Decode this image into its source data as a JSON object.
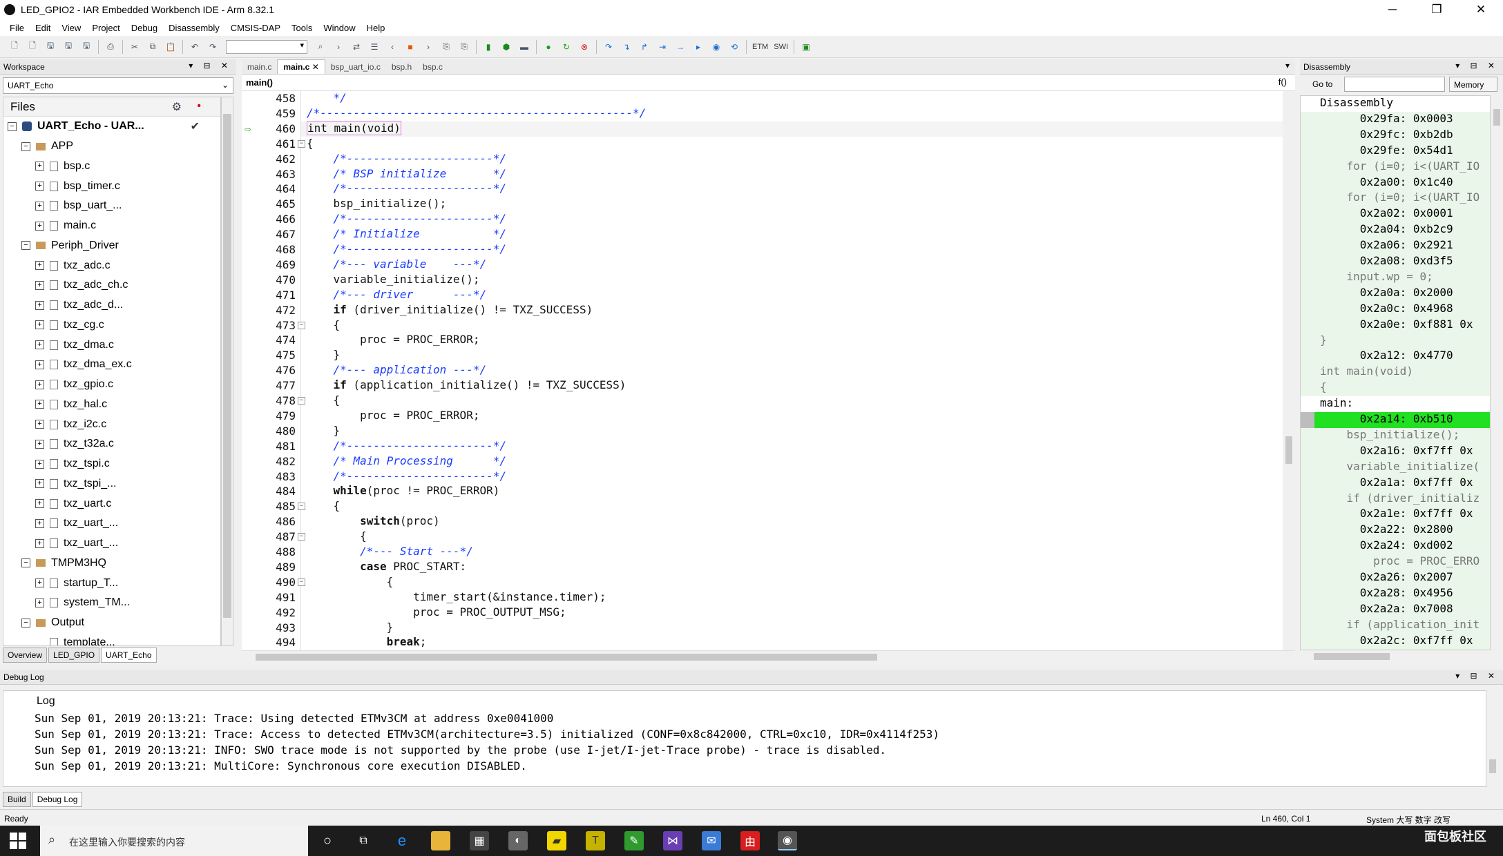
{
  "window": {
    "title": "LED_GPIO2 - IAR Embedded Workbench IDE - Arm 8.32.1",
    "minimize": "─",
    "maximize": "❐",
    "close": "✕"
  },
  "menu": [
    "File",
    "Edit",
    "View",
    "Project",
    "Debug",
    "Disassembly",
    "CMSIS-DAP",
    "Tools",
    "Window",
    "Help"
  ],
  "toolbar": {
    "etm_label": "ETM",
    "swi_label": "SWI"
  },
  "workspace": {
    "header": "Workspace",
    "combo": "UART_Echo",
    "files_header": "Files",
    "tree": [
      {
        "label": "UART_Echo - UAR...",
        "level": 0,
        "kind": "project",
        "exp": "−",
        "bold": true,
        "check": "✔"
      },
      {
        "label": "APP",
        "level": 1,
        "kind": "folder",
        "exp": "−"
      },
      {
        "label": "bsp.c",
        "level": 2,
        "kind": "file",
        "exp": "+"
      },
      {
        "label": "bsp_timer.c",
        "level": 2,
        "kind": "file",
        "exp": "+"
      },
      {
        "label": "bsp_uart_...",
        "level": 2,
        "kind": "file",
        "exp": "+"
      },
      {
        "label": "main.c",
        "level": 2,
        "kind": "file",
        "exp": "+"
      },
      {
        "label": "Periph_Driver",
        "level": 1,
        "kind": "folder",
        "exp": "−"
      },
      {
        "label": "txz_adc.c",
        "level": 2,
        "kind": "file",
        "exp": "+"
      },
      {
        "label": "txz_adc_ch.c",
        "level": 2,
        "kind": "file",
        "exp": "+"
      },
      {
        "label": "txz_adc_d...",
        "level": 2,
        "kind": "file",
        "exp": "+"
      },
      {
        "label": "txz_cg.c",
        "level": 2,
        "kind": "file",
        "exp": "+"
      },
      {
        "label": "txz_dma.c",
        "level": 2,
        "kind": "file",
        "exp": "+"
      },
      {
        "label": "txz_dma_ex.c",
        "level": 2,
        "kind": "file",
        "exp": "+"
      },
      {
        "label": "txz_gpio.c",
        "level": 2,
        "kind": "file",
        "exp": "+"
      },
      {
        "label": "txz_hal.c",
        "level": 2,
        "kind": "file",
        "exp": "+"
      },
      {
        "label": "txz_i2c.c",
        "level": 2,
        "kind": "file",
        "exp": "+"
      },
      {
        "label": "txz_t32a.c",
        "level": 2,
        "kind": "file",
        "exp": "+"
      },
      {
        "label": "txz_tspi.c",
        "level": 2,
        "kind": "file",
        "exp": "+"
      },
      {
        "label": "txz_tspi_...",
        "level": 2,
        "kind": "file",
        "exp": "+"
      },
      {
        "label": "txz_uart.c",
        "level": 2,
        "kind": "file",
        "exp": "+"
      },
      {
        "label": "txz_uart_...",
        "level": 2,
        "kind": "file",
        "exp": "+"
      },
      {
        "label": "txz_uart_...",
        "level": 2,
        "kind": "file",
        "exp": "+"
      },
      {
        "label": "TMPM3HQ",
        "level": 1,
        "kind": "folder",
        "exp": "−"
      },
      {
        "label": "startup_T...",
        "level": 2,
        "kind": "file",
        "exp": "+"
      },
      {
        "label": "system_TM...",
        "level": 2,
        "kind": "file",
        "exp": "+"
      },
      {
        "label": "Output",
        "level": 1,
        "kind": "folder",
        "exp": "−"
      },
      {
        "label": "template...",
        "level": 2,
        "kind": "file",
        "exp": ""
      }
    ],
    "tabs": [
      "Overview",
      "LED_GPIO",
      "UART_Echo"
    ]
  },
  "editor": {
    "tabs": [
      "main.c",
      "main.c",
      "bsp_uart_io.c",
      "bsp.h",
      "bsp.c"
    ],
    "function_combo": "main()",
    "fx_label": "f()",
    "lines": [
      {
        "n": "458",
        "segs": [
          {
            "t": "    */",
            "c": "cm"
          }
        ]
      },
      {
        "n": "459",
        "segs": [
          {
            "t": "/*-----------------------------------------------*/",
            "c": "cm"
          }
        ]
      },
      {
        "n": "460",
        "cur": true,
        "segs": [
          {
            "t": "int main(void)",
            "c": "hl"
          }
        ]
      },
      {
        "n": "461",
        "fold": "−",
        "segs": [
          {
            "t": "{",
            "c": ""
          }
        ]
      },
      {
        "n": "462",
        "segs": [
          {
            "t": "    ",
            "c": ""
          },
          {
            "t": "/*----------------------*/",
            "c": "cm"
          }
        ]
      },
      {
        "n": "463",
        "segs": [
          {
            "t": "    ",
            "c": ""
          },
          {
            "t": "/* BSP initialize       */",
            "c": "cm"
          }
        ]
      },
      {
        "n": "464",
        "segs": [
          {
            "t": "    ",
            "c": ""
          },
          {
            "t": "/*----------------------*/",
            "c": "cm"
          }
        ]
      },
      {
        "n": "465",
        "segs": [
          {
            "t": "    bsp_initialize();",
            "c": ""
          }
        ]
      },
      {
        "n": "466",
        "segs": [
          {
            "t": "    ",
            "c": ""
          },
          {
            "t": "/*----------------------*/",
            "c": "cm"
          }
        ]
      },
      {
        "n": "467",
        "segs": [
          {
            "t": "    ",
            "c": ""
          },
          {
            "t": "/* Initialize           */",
            "c": "cm"
          }
        ]
      },
      {
        "n": "468",
        "segs": [
          {
            "t": "    ",
            "c": ""
          },
          {
            "t": "/*----------------------*/",
            "c": "cm"
          }
        ]
      },
      {
        "n": "469",
        "segs": [
          {
            "t": "    ",
            "c": ""
          },
          {
            "t": "/*--- variable    ---*/",
            "c": "cm"
          }
        ]
      },
      {
        "n": "470",
        "segs": [
          {
            "t": "    variable_initialize();",
            "c": ""
          }
        ]
      },
      {
        "n": "471",
        "segs": [
          {
            "t": "    ",
            "c": ""
          },
          {
            "t": "/*--- driver      ---*/",
            "c": "cm"
          }
        ]
      },
      {
        "n": "472",
        "segs": [
          {
            "t": "    ",
            "c": ""
          },
          {
            "t": "if",
            "c": "kw"
          },
          {
            "t": " (driver_initialize() != TXZ_SUCCESS)",
            "c": ""
          }
        ]
      },
      {
        "n": "473",
        "fold": "−",
        "segs": [
          {
            "t": "    {",
            "c": ""
          }
        ]
      },
      {
        "n": "474",
        "segs": [
          {
            "t": "        proc = PROC_ERROR;",
            "c": ""
          }
        ]
      },
      {
        "n": "475",
        "segs": [
          {
            "t": "    }",
            "c": ""
          }
        ]
      },
      {
        "n": "476",
        "segs": [
          {
            "t": "    ",
            "c": ""
          },
          {
            "t": "/*--- application ---*/",
            "c": "cm"
          }
        ]
      },
      {
        "n": "477",
        "segs": [
          {
            "t": "    ",
            "c": ""
          },
          {
            "t": "if",
            "c": "kw"
          },
          {
            "t": " (application_initialize() != TXZ_SUCCESS)",
            "c": ""
          }
        ]
      },
      {
        "n": "478",
        "fold": "−",
        "segs": [
          {
            "t": "    {",
            "c": ""
          }
        ]
      },
      {
        "n": "479",
        "segs": [
          {
            "t": "        proc = PROC_ERROR;",
            "c": ""
          }
        ]
      },
      {
        "n": "480",
        "segs": [
          {
            "t": "    }",
            "c": ""
          }
        ]
      },
      {
        "n": "481",
        "segs": [
          {
            "t": "    ",
            "c": ""
          },
          {
            "t": "/*----------------------*/",
            "c": "cm"
          }
        ]
      },
      {
        "n": "482",
        "segs": [
          {
            "t": "    ",
            "c": ""
          },
          {
            "t": "/* Main Processing      */",
            "c": "cm"
          }
        ]
      },
      {
        "n": "483",
        "segs": [
          {
            "t": "    ",
            "c": ""
          },
          {
            "t": "/*----------------------*/",
            "c": "cm"
          }
        ]
      },
      {
        "n": "484",
        "segs": [
          {
            "t": "    ",
            "c": ""
          },
          {
            "t": "while",
            "c": "kw"
          },
          {
            "t": "(proc != PROC_ERROR)",
            "c": ""
          }
        ]
      },
      {
        "n": "485",
        "fold": "−",
        "segs": [
          {
            "t": "    {",
            "c": ""
          }
        ]
      },
      {
        "n": "486",
        "segs": [
          {
            "t": "        ",
            "c": ""
          },
          {
            "t": "switch",
            "c": "kw"
          },
          {
            "t": "(proc)",
            "c": ""
          }
        ]
      },
      {
        "n": "487",
        "fold": "−",
        "segs": [
          {
            "t": "        {",
            "c": ""
          }
        ]
      },
      {
        "n": "488",
        "segs": [
          {
            "t": "        ",
            "c": ""
          },
          {
            "t": "/*--- Start ---*/",
            "c": "cm"
          }
        ]
      },
      {
        "n": "489",
        "segs": [
          {
            "t": "        ",
            "c": ""
          },
          {
            "t": "case",
            "c": "kw"
          },
          {
            "t": " PROC_START:",
            "c": ""
          }
        ]
      },
      {
        "n": "490",
        "fold": "−",
        "segs": [
          {
            "t": "            {",
            "c": ""
          }
        ]
      },
      {
        "n": "491",
        "segs": [
          {
            "t": "                timer_start(&instance.timer);",
            "c": ""
          }
        ]
      },
      {
        "n": "492",
        "segs": [
          {
            "t": "                proc = PROC_OUTPUT_MSG;",
            "c": ""
          }
        ]
      },
      {
        "n": "493",
        "segs": [
          {
            "t": "            }",
            "c": ""
          }
        ]
      },
      {
        "n": "494",
        "segs": [
          {
            "t": "            ",
            "c": ""
          },
          {
            "t": "break",
            "c": "kw"
          },
          {
            "t": ";",
            "c": ""
          }
        ]
      }
    ]
  },
  "disassembly": {
    "header": "Disassembly",
    "goto_label": "Go to",
    "memory_label": "Memory",
    "lines": [
      {
        "t": "Disassembly",
        "k": "hdr"
      },
      {
        "t": "      0x29fa: 0x0003",
        "k": "asm"
      },
      {
        "t": "      0x29fc: 0xb2db",
        "k": "asm"
      },
      {
        "t": "      0x29fe: 0x54d1",
        "k": "asm"
      },
      {
        "t": "    for (i=0; i<(UART_IO",
        "k": "src"
      },
      {
        "t": "      0x2a00: 0x1c40",
        "k": "asm"
      },
      {
        "t": "    for (i=0; i<(UART_IO",
        "k": "src"
      },
      {
        "t": "      0x2a02: 0x0001",
        "k": "asm"
      },
      {
        "t": "      0x2a04: 0xb2c9",
        "k": "asm"
      },
      {
        "t": "      0x2a06: 0x2921",
        "k": "asm"
      },
      {
        "t": "      0x2a08: 0xd3f5",
        "k": "asm"
      },
      {
        "t": "    input.wp = 0;",
        "k": "src"
      },
      {
        "t": "      0x2a0a: 0x2000",
        "k": "asm"
      },
      {
        "t": "      0x2a0c: 0x4968",
        "k": "asm"
      },
      {
        "t": "      0x2a0e: 0xf881 0x",
        "k": "asm"
      },
      {
        "t": "}",
        "k": "src"
      },
      {
        "t": "      0x2a12: 0x4770",
        "k": "asm"
      },
      {
        "t": "int main(void)",
        "k": "src"
      },
      {
        "t": "{",
        "k": "src"
      },
      {
        "t": "main:",
        "k": "lbl"
      },
      {
        "t": "      0x2a14: 0xb510",
        "k": "cur"
      },
      {
        "t": "    bsp_initialize();",
        "k": "src"
      },
      {
        "t": "      0x2a16: 0xf7ff 0x",
        "k": "asm"
      },
      {
        "t": "    variable_initialize(",
        "k": "src"
      },
      {
        "t": "      0x2a1a: 0xf7ff 0x",
        "k": "asm"
      },
      {
        "t": "    if (driver_initializ",
        "k": "src"
      },
      {
        "t": "      0x2a1e: 0xf7ff 0x",
        "k": "asm"
      },
      {
        "t": "      0x2a22: 0x2800",
        "k": "asm"
      },
      {
        "t": "      0x2a24: 0xd002",
        "k": "asm"
      },
      {
        "t": "        proc = PROC_ERRO",
        "k": "src"
      },
      {
        "t": "      0x2a26: 0x2007",
        "k": "asm"
      },
      {
        "t": "      0x2a28: 0x4956",
        "k": "asm"
      },
      {
        "t": "      0x2a2a: 0x7008",
        "k": "asm"
      },
      {
        "t": "    if (application_init",
        "k": "src"
      },
      {
        "t": "      0x2a2c: 0xf7ff 0x",
        "k": "asm"
      }
    ]
  },
  "debug_log": {
    "header": "Debug Log",
    "column": "Log",
    "lines": [
      "Sun Sep 01, 2019 20:13:21: Trace: Using detected ETMv3CM at address 0xe0041000",
      "Sun Sep 01, 2019 20:13:21: Trace: Access to detected ETMv3CM(architecture=3.5) initialized (CONF=0x8c842000, CTRL=0xc10, IDR=0x4114f253)",
      "Sun Sep 01, 2019 20:13:21: INFO: SWO trace mode is not supported by the probe (use I-jet/I-jet-Trace probe) - trace is disabled.",
      "Sun Sep 01, 2019 20:13:21: MultiCore: Synchronous core execution DISABLED."
    ],
    "tabs": [
      "Build",
      "Debug Log"
    ]
  },
  "status": {
    "left": "Ready",
    "position": "Ln 460, Col 1",
    "locale": "System  大写  数字  改写"
  },
  "taskbar": {
    "search_placeholder": "在这里输入你要搜索的内容",
    "watermark": "面包板社区"
  }
}
